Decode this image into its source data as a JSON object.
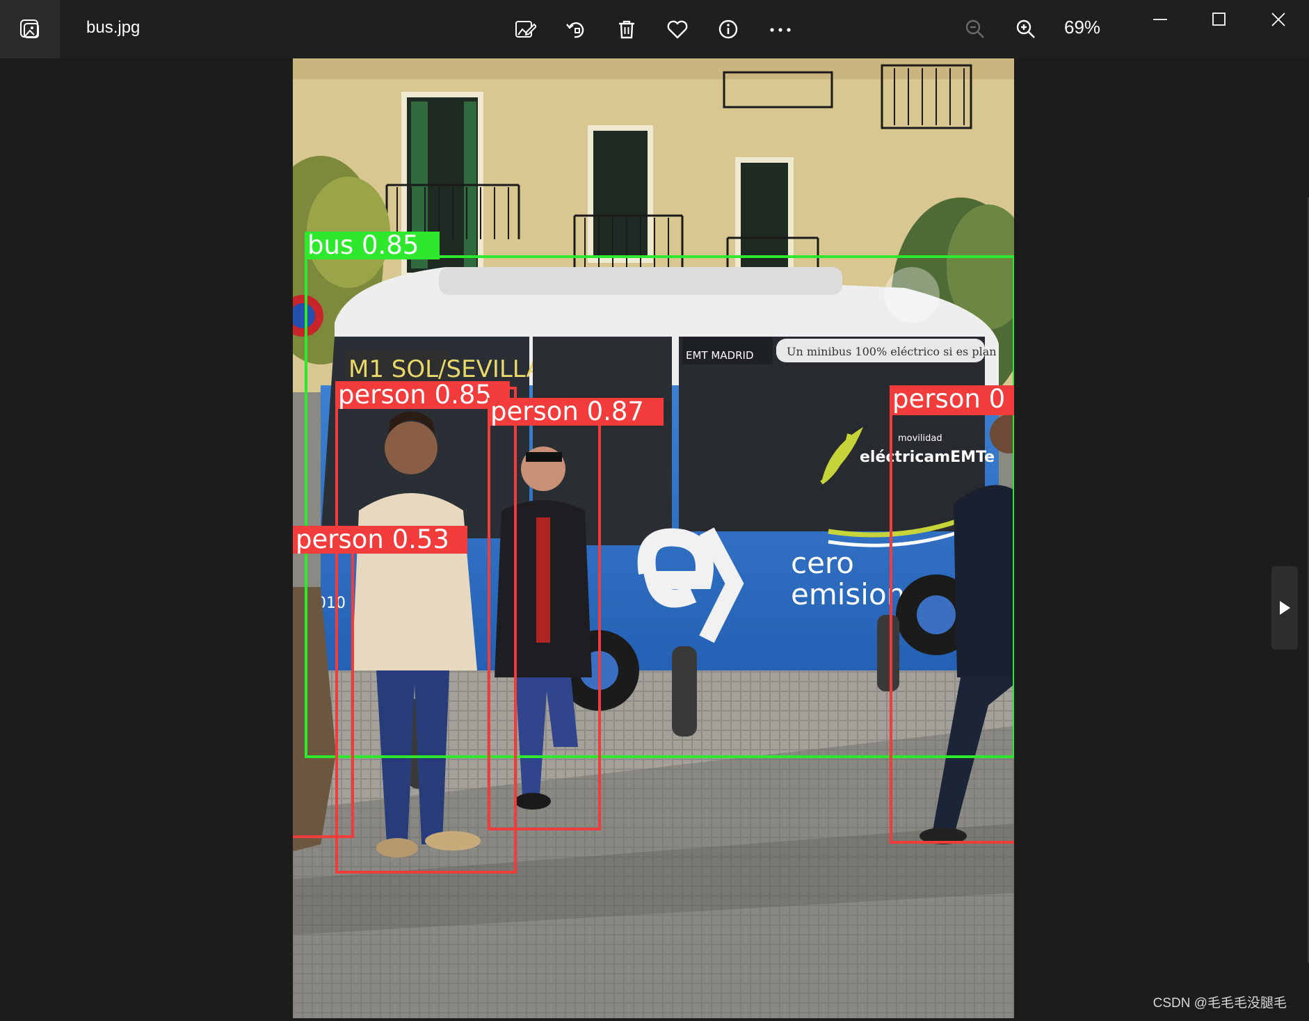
{
  "window": {
    "filename": "bus.jpg",
    "zoom": "69%",
    "controls": {
      "minimize": "minimize-icon",
      "maximize": "maximize-icon",
      "close": "close-icon"
    }
  },
  "toolbar": {
    "icons": [
      "edit-image-icon",
      "rotate-icon",
      "delete-icon",
      "favorite-icon",
      "info-icon",
      "more-icon"
    ],
    "zoom_out": "zoom-out-icon",
    "zoom_in": "zoom-in-icon"
  },
  "detections": [
    {
      "label": "bus 0.85",
      "class": "bus",
      "confidence": 0.85,
      "color": "#2ee82e"
    },
    {
      "label": "person 0.85",
      "class": "person",
      "confidence": 0.85,
      "color": "#f23b3b"
    },
    {
      "label": "person 0.87",
      "class": "person",
      "confidence": 0.87,
      "color": "#f23b3b"
    },
    {
      "label": "person 0.53",
      "class": "person",
      "confidence": 0.53,
      "color": "#f23b3b"
    },
    {
      "label": "person 0",
      "class": "person",
      "color": "#f23b3b"
    }
  ],
  "bus_signs": {
    "route": "M1 SOL/SEVILLA",
    "operator": "EMT MADRID",
    "slogan": "Un minibus 100% eléctrico si es plan",
    "campaign": "eléctricamEMTe",
    "campaign_kicker": "movilidad",
    "side_text_1": "cero",
    "side_text_2": "emisiones",
    "fleet_no": "0010"
  },
  "watermark": "CSDN @毛毛毛没腿毛"
}
